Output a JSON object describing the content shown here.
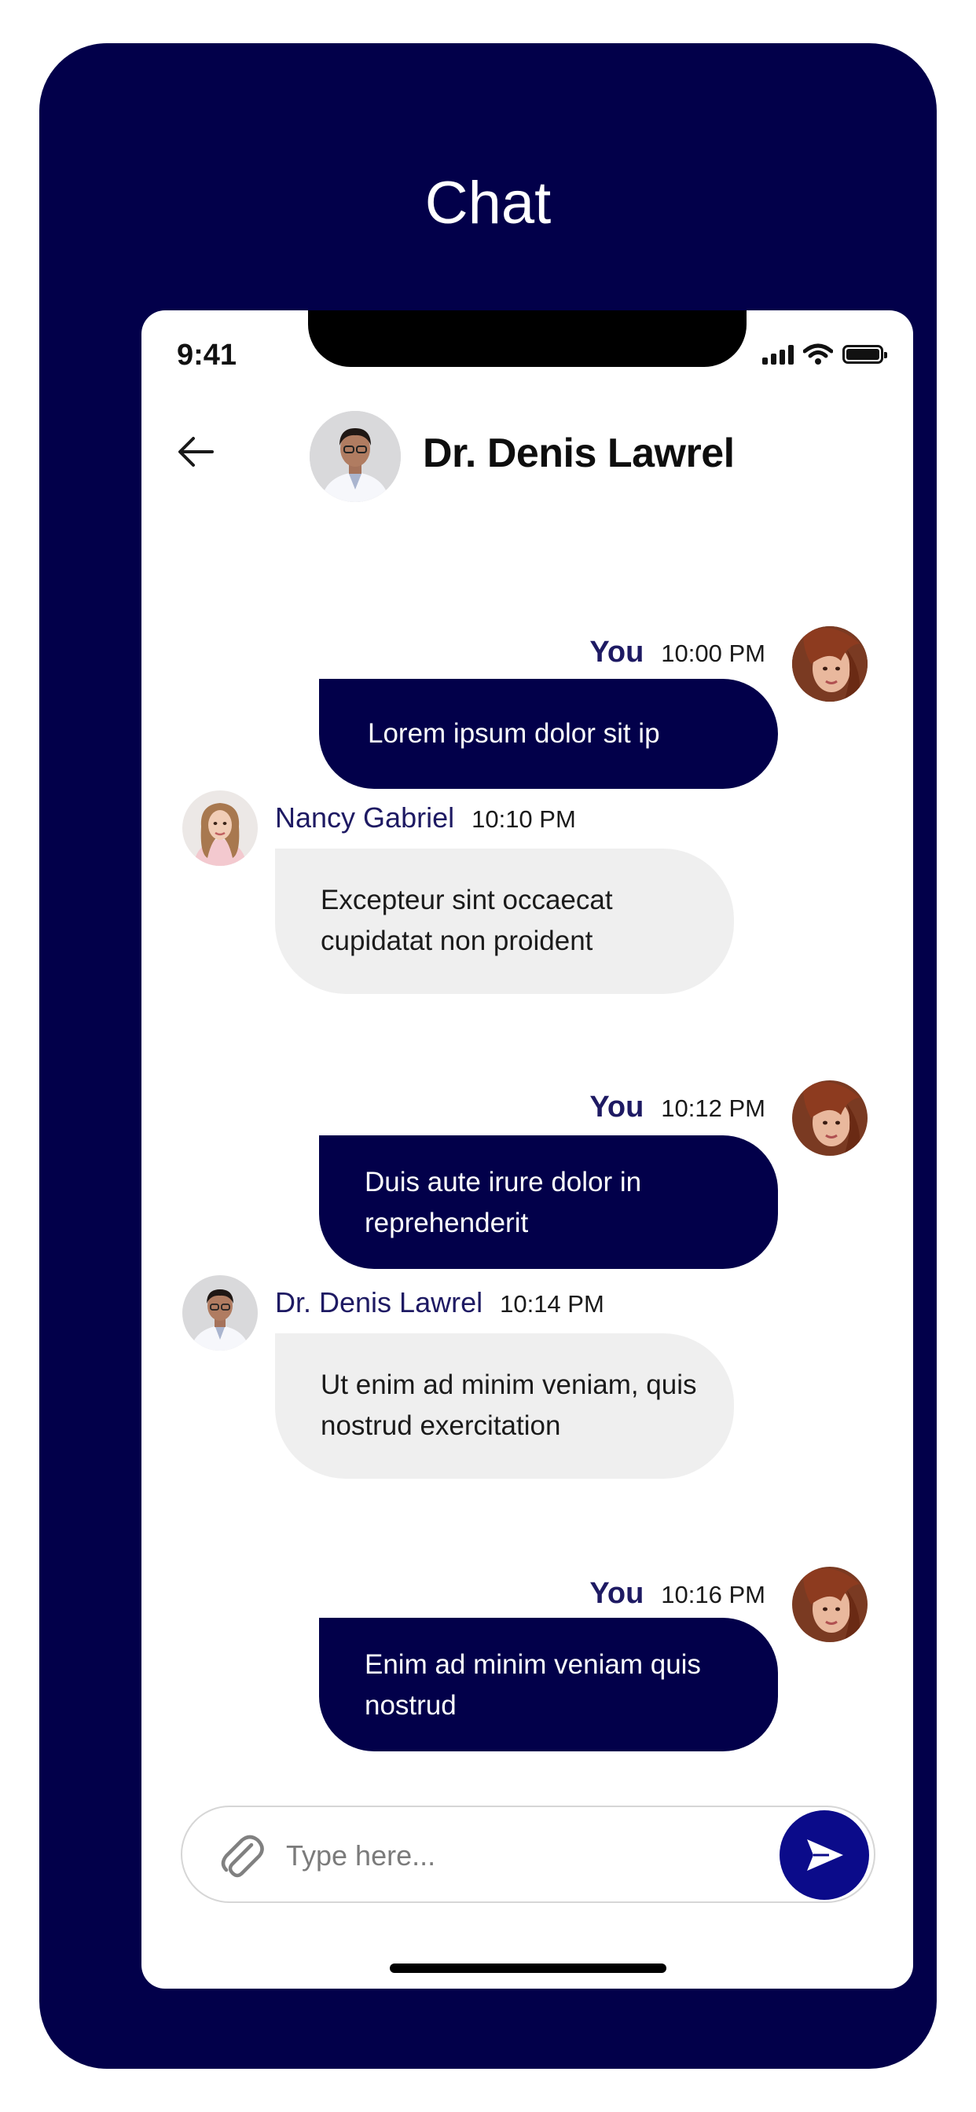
{
  "page": {
    "title": "Chat"
  },
  "status_bar": {
    "time": "9:41"
  },
  "header": {
    "contact_name": "Dr. Denis Lawrel"
  },
  "messages": [
    {
      "sender": "You",
      "time": "10:00 PM",
      "text": "Lorem ipsum dolor sit ip",
      "direction": "outgoing"
    },
    {
      "sender": "Nancy Gabriel",
      "time": "10:10 PM",
      "text": "Excepteur sint occaecat cupidatat non proident",
      "direction": "incoming"
    },
    {
      "sender": "You",
      "time": "10:12 PM",
      "text": "Duis aute irure dolor in reprehenderit",
      "direction": "outgoing"
    },
    {
      "sender": "Dr. Denis Lawrel",
      "time": "10:14 PM",
      "text": "Ut enim ad minim veniam, quis nostrud exercitation",
      "direction": "incoming"
    },
    {
      "sender": "You",
      "time": "10:16 PM",
      "text": "Enim ad minim veniam quis nostrud",
      "direction": "outgoing"
    }
  ],
  "composer": {
    "placeholder": "Type here..."
  },
  "icons": {
    "back": "arrow-left-icon",
    "attach": "paperclip-icon",
    "send": "send-icon"
  },
  "colors": {
    "background": "#02004a",
    "outgoing_bubble": "#02004a",
    "incoming_bubble": "#efefef",
    "sender_name": "#1e1a63",
    "send_button": "#0b0b8a"
  }
}
